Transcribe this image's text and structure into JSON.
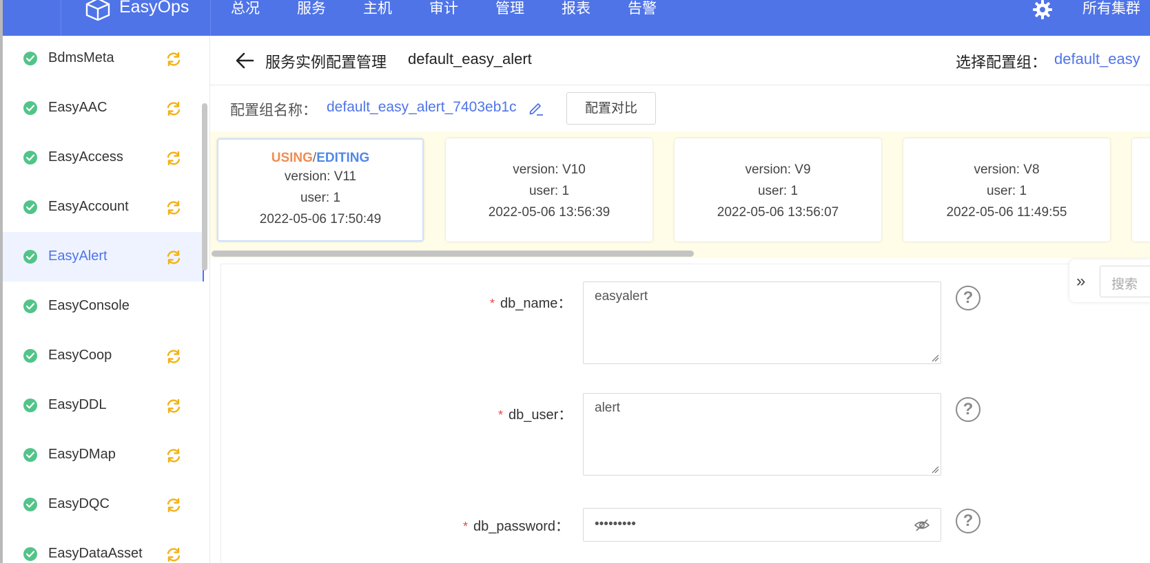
{
  "nav": {
    "brand": "EasyOps",
    "items": [
      "总况",
      "服务",
      "主机",
      "审计",
      "管理",
      "报表",
      "告警"
    ],
    "cluster": "所有集群",
    "accent": "#4f74e8"
  },
  "sidebar": {
    "items": [
      {
        "label": "BdmsMeta",
        "sync": true
      },
      {
        "label": "EasyAAC",
        "sync": true
      },
      {
        "label": "EasyAccess",
        "sync": true
      },
      {
        "label": "EasyAccount",
        "sync": true
      },
      {
        "label": "EasyAlert",
        "sync": true,
        "active": true
      },
      {
        "label": "EasyConsole",
        "sync": false
      },
      {
        "label": "EasyCoop",
        "sync": true
      },
      {
        "label": "EasyDDL",
        "sync": true
      },
      {
        "label": "EasyDMap",
        "sync": true
      },
      {
        "label": "EasyDQC",
        "sync": true
      },
      {
        "label": "EasyDataAsset",
        "sync": true
      }
    ]
  },
  "header": {
    "title": "服务实例配置管理",
    "service_name": "default_easy_alert",
    "select_label": "选择配置组：",
    "select_value": "default_easy"
  },
  "group": {
    "label": "配置组名称：",
    "value": "default_easy_alert_7403eb1c",
    "compare_button": "配置对比"
  },
  "versions": [
    {
      "status_using": "USING",
      "status_sep": "/",
      "status_editing": "EDITING",
      "version": "version: V11",
      "user": "user: 1",
      "time": "2022-05-06 17:50:49",
      "current": true
    },
    {
      "version": "version: V10",
      "user": "user: 1",
      "time": "2022-05-06 13:56:39"
    },
    {
      "version": "version: V9",
      "user": "user: 1",
      "time": "2022-05-06 13:56:07"
    },
    {
      "version": "version: V8",
      "user": "user: 1",
      "time": "2022-05-06 11:49:55"
    }
  ],
  "form": {
    "fields": [
      {
        "label": "db_name：",
        "value": "easyalert"
      },
      {
        "label": "db_user：",
        "value": "alert"
      },
      {
        "label": "db_password：",
        "value": "•••••••••"
      }
    ],
    "required_mark": "*",
    "help_glyph": "?"
  },
  "search": {
    "toggle": "»",
    "placeholder": "搜索"
  }
}
